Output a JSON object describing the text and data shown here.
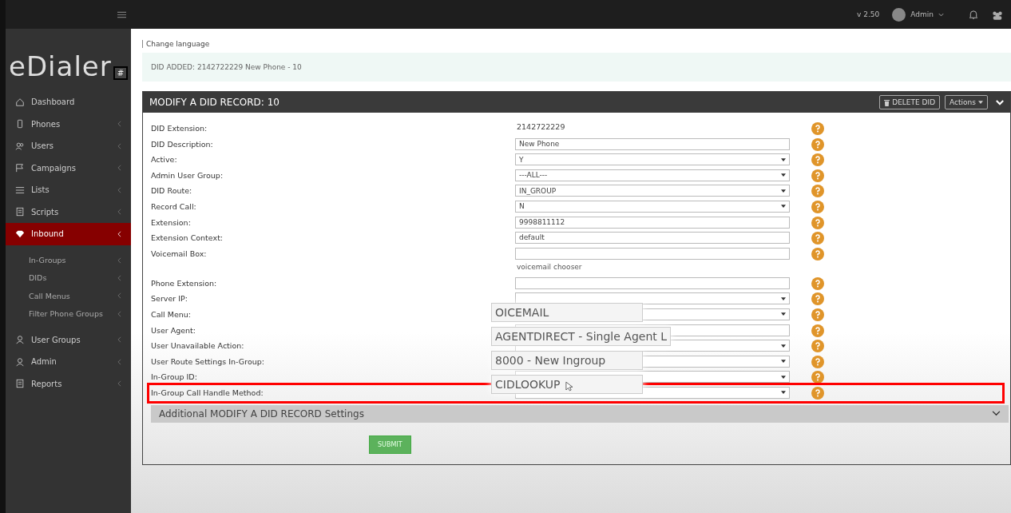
{
  "topbar": {
    "version": "v 2.50",
    "user": "Admin"
  },
  "logo": {
    "text": "eDialer",
    "mark": "#"
  },
  "sidebar": {
    "items": [
      {
        "label": "Dashboard",
        "selected": false,
        "arrow": false
      },
      {
        "label": "Phones",
        "selected": false,
        "arrow": true
      },
      {
        "label": "Users",
        "selected": false,
        "arrow": true
      },
      {
        "label": "Campaigns",
        "selected": false,
        "arrow": true
      },
      {
        "label": "Lists",
        "selected": false,
        "arrow": true
      },
      {
        "label": "Scripts",
        "selected": false,
        "arrow": true
      },
      {
        "label": "Inbound",
        "selected": true,
        "arrow": true,
        "children": [
          {
            "label": "In-Groups"
          },
          {
            "label": "DIDs"
          },
          {
            "label": "Call Menus"
          },
          {
            "label": "Filter Phone Groups"
          }
        ]
      },
      {
        "label": "User Groups",
        "selected": false,
        "arrow": true
      },
      {
        "label": "Admin",
        "selected": false,
        "arrow": true
      },
      {
        "label": "Reports",
        "selected": false,
        "arrow": true
      }
    ]
  },
  "language_link": "Change language",
  "alert": "DID ADDED: 2142722229 New Phone - 10",
  "panel": {
    "title": "MODIFY A DID RECORD: 10",
    "delete_button": "DELETE DID",
    "actions_button": "Actions",
    "fields": [
      {
        "label": "DID Extension:",
        "kind": "text",
        "value": "2142722229"
      },
      {
        "label": "DID Description:",
        "kind": "input",
        "value": "New Phone"
      },
      {
        "label": "Active:",
        "kind": "select",
        "value": "Y"
      },
      {
        "label": "Admin User Group:",
        "kind": "select",
        "value": "---ALL---"
      },
      {
        "label": "DID Route:",
        "kind": "select",
        "value": "IN_GROUP"
      },
      {
        "label": "Record Call:",
        "kind": "select",
        "value": "N"
      },
      {
        "label": "Extension:",
        "kind": "input",
        "value": "9998811112"
      },
      {
        "label": "Extension Context:",
        "kind": "input",
        "value": "default"
      },
      {
        "label": "Voicemail Box:",
        "kind": "input",
        "note": "voicemail chooser"
      },
      {
        "label": "Phone Extension:",
        "kind": "input"
      },
      {
        "label": "Server IP:",
        "kind": "select"
      },
      {
        "label": "Call Menu:",
        "kind": "select"
      },
      {
        "label": "User Agent:",
        "kind": "input"
      },
      {
        "label": "User Unavailable Action:",
        "kind": "select"
      },
      {
        "label": "User Route Settings In-Group:",
        "kind": "select"
      },
      {
        "label": "In-Group ID:",
        "kind": "select"
      },
      {
        "label": "In-Group Call Handle Method:",
        "kind": "select",
        "highlighted": true
      }
    ],
    "magnified_values": [
      "OICEMAIL",
      "AGENTDIRECT - Single Agent L",
      "8000 - New Ingroup",
      "CIDLOOKUP"
    ],
    "additional_settings": "Additional MODIFY A DID RECORD Settings",
    "submit": "SUBMIT"
  }
}
